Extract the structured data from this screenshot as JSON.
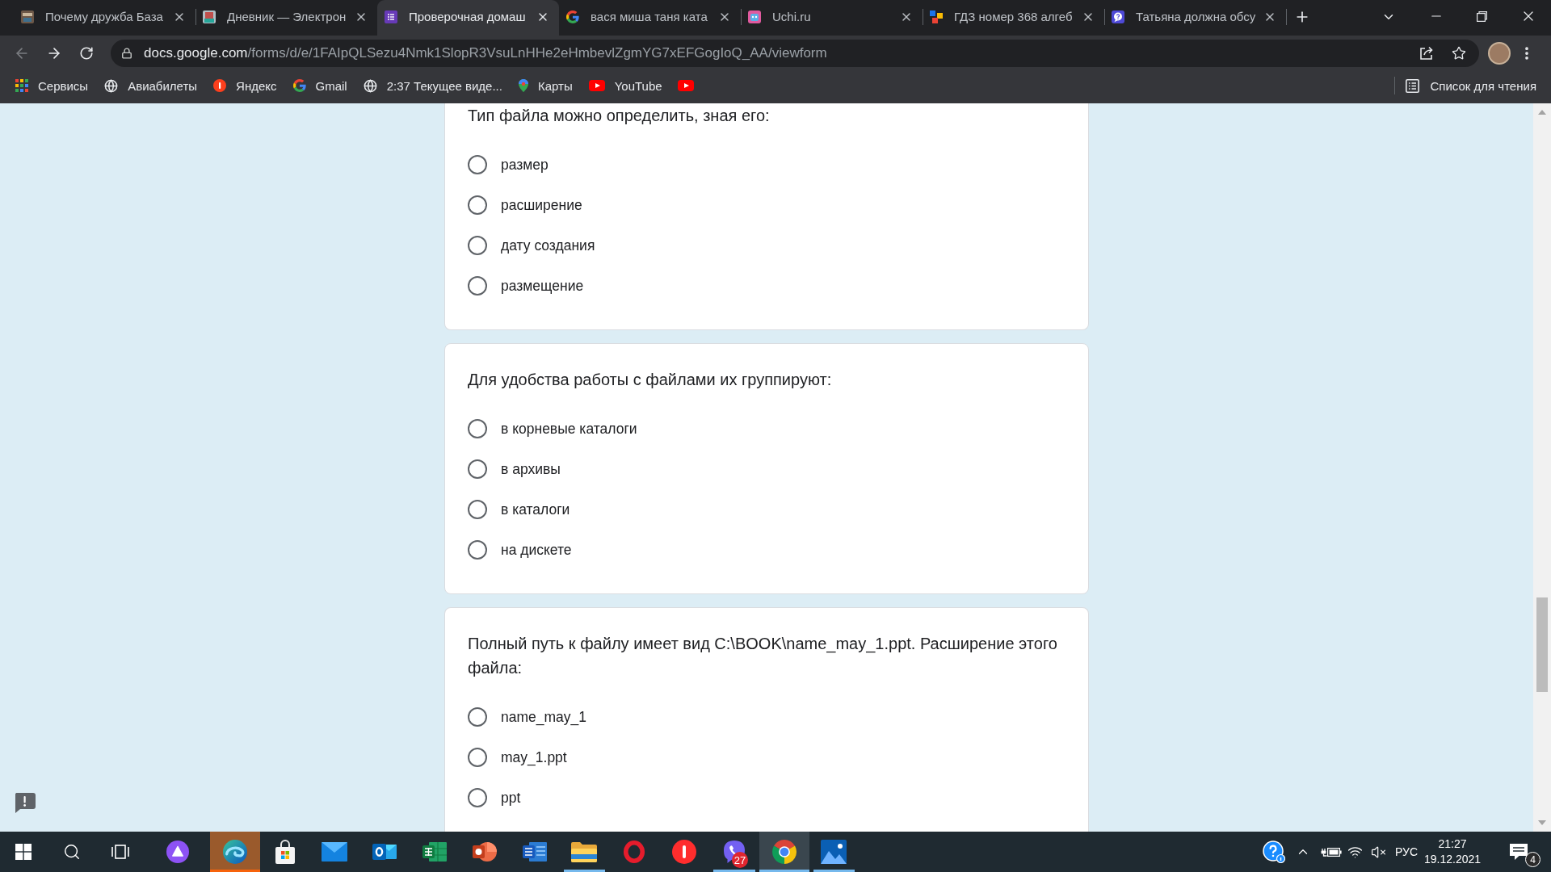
{
  "browser": {
    "tabs": [
      {
        "title": "Почему дружба База",
        "selected": false
      },
      {
        "title": "Дневник — Электрон",
        "selected": false
      },
      {
        "title": "Проверочная домаш",
        "selected": true
      },
      {
        "title": "вася миша таня ката",
        "selected": false
      },
      {
        "title": "Uchi.ru",
        "selected": false
      },
      {
        "title": "ГДЗ номер 368 алгеб",
        "selected": false
      },
      {
        "title": "Татьяна должна обсу",
        "selected": false
      }
    ],
    "back_disabled": true,
    "address": {
      "host": "docs.google.com",
      "path": "/forms/d/e/1FAIpQLSezu4Nmk1SlopR3VsuLnHHe2eHmbevlZgmYG7xEFGogIoQ_AA/viewform"
    },
    "bookmarks": [
      {
        "kind": "link",
        "label": "Сервисы"
      },
      {
        "kind": "link",
        "label": "Авиабилеты"
      },
      {
        "kind": "link",
        "label": "Яндекс"
      },
      {
        "kind": "link",
        "label": "Gmail"
      },
      {
        "kind": "link",
        "label": "2:37 Текущее виде..."
      },
      {
        "kind": "link",
        "label": "Карты"
      },
      {
        "kind": "link",
        "label": "YouTube"
      },
      {
        "kind": "icon"
      }
    ],
    "reading_list": "Список для чтения"
  },
  "form": {
    "questions": [
      {
        "text": "Тип файла можно определить, зная его:",
        "options": [
          {
            "label": "размер",
            "selected": false
          },
          {
            "label": "расширение",
            "selected": false
          },
          {
            "label": "дату создания",
            "selected": false
          },
          {
            "label": "размещение",
            "selected": false
          }
        ]
      },
      {
        "text": "Для удобства работы с файлами их группируют:",
        "options": [
          {
            "label": "в корневые каталоги",
            "selected": false
          },
          {
            "label": "в архивы",
            "selected": false
          },
          {
            "label": "в каталоги",
            "selected": false
          },
          {
            "label": "на дискете",
            "selected": false
          }
        ]
      },
      {
        "text": "Полный путь к файлу имеет вид C:\\BOOK\\name_may_1.ppt. Расширение этого файла:",
        "options": [
          {
            "label": "name_may_1",
            "selected": false
          },
          {
            "label": "may_1.ppt",
            "selected": false
          },
          {
            "label": "ppt",
            "selected": false
          }
        ]
      }
    ]
  },
  "taskbar": {
    "apps": [
      {
        "running": true,
        "active": false,
        "attention": true
      },
      {
        "running": false,
        "active": false,
        "attention": false
      },
      {
        "running": false,
        "active": false,
        "attention": false
      },
      {
        "running": false,
        "active": false,
        "attention": false
      },
      {
        "running": false,
        "active": false,
        "attention": false
      },
      {
        "running": false,
        "active": false,
        "attention": false
      },
      {
        "running": false,
        "active": false,
        "attention": false
      },
      {
        "running": true,
        "active": false,
        "attention": false
      },
      {
        "running": false,
        "active": false,
        "attention": false
      },
      {
        "running": false,
        "active": false,
        "attention": false
      },
      {
        "running": true,
        "active": false,
        "attention": false,
        "badge": "27"
      },
      {
        "running": true,
        "active": true,
        "attention": false
      },
      {
        "running": true,
        "active": false,
        "attention": false
      }
    ],
    "tray": {
      "language": "РУС",
      "time": "21:27",
      "date": "19.12.2021",
      "notification_count": "4"
    }
  }
}
